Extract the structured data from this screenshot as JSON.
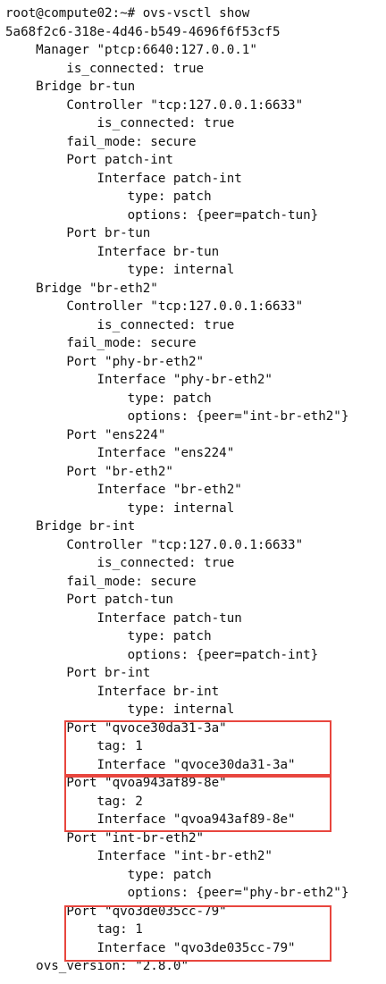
{
  "terminal": {
    "lines": [
      "root@compute02:~# ovs-vsctl show",
      "5a68f2c6-318e-4d46-b549-4696f6f53cf5",
      "    Manager \"ptcp:6640:127.0.0.1\"",
      "        is_connected: true",
      "    Bridge br-tun",
      "        Controller \"tcp:127.0.0.1:6633\"",
      "            is_connected: true",
      "        fail_mode: secure",
      "        Port patch-int",
      "            Interface patch-int",
      "                type: patch",
      "                options: {peer=patch-tun}",
      "        Port br-tun",
      "            Interface br-tun",
      "                type: internal",
      "    Bridge \"br-eth2\"",
      "        Controller \"tcp:127.0.0.1:6633\"",
      "            is_connected: true",
      "        fail_mode: secure",
      "        Port \"phy-br-eth2\"",
      "            Interface \"phy-br-eth2\"",
      "                type: patch",
      "                options: {peer=\"int-br-eth2\"}",
      "        Port \"ens224\"",
      "            Interface \"ens224\"",
      "        Port \"br-eth2\"",
      "            Interface \"br-eth2\"",
      "                type: internal",
      "    Bridge br-int",
      "        Controller \"tcp:127.0.0.1:6633\"",
      "            is_connected: true",
      "        fail_mode: secure",
      "        Port patch-tun",
      "            Interface patch-tun",
      "                type: patch",
      "                options: {peer=patch-int}",
      "        Port br-int",
      "            Interface br-int",
      "                type: internal",
      "        Port \"qvoce30da31-3a\"",
      "            tag: 1",
      "            Interface \"qvoce30da31-3a\"",
      "        Port \"qvoa943af89-8e\"",
      "            tag: 2",
      "            Interface \"qvoa943af89-8e\"",
      "        Port \"int-br-eth2\"",
      "            Interface \"int-br-eth2\"",
      "                type: patch",
      "                options: {peer=\"phy-br-eth2\"}",
      "        Port \"qvo3de035cc-79\"",
      "            tag: 1",
      "            Interface \"qvo3de035cc-79\"",
      "    ovs_version: \"2.8.0\""
    ]
  },
  "highlights": {
    "color": "#e8463e"
  }
}
